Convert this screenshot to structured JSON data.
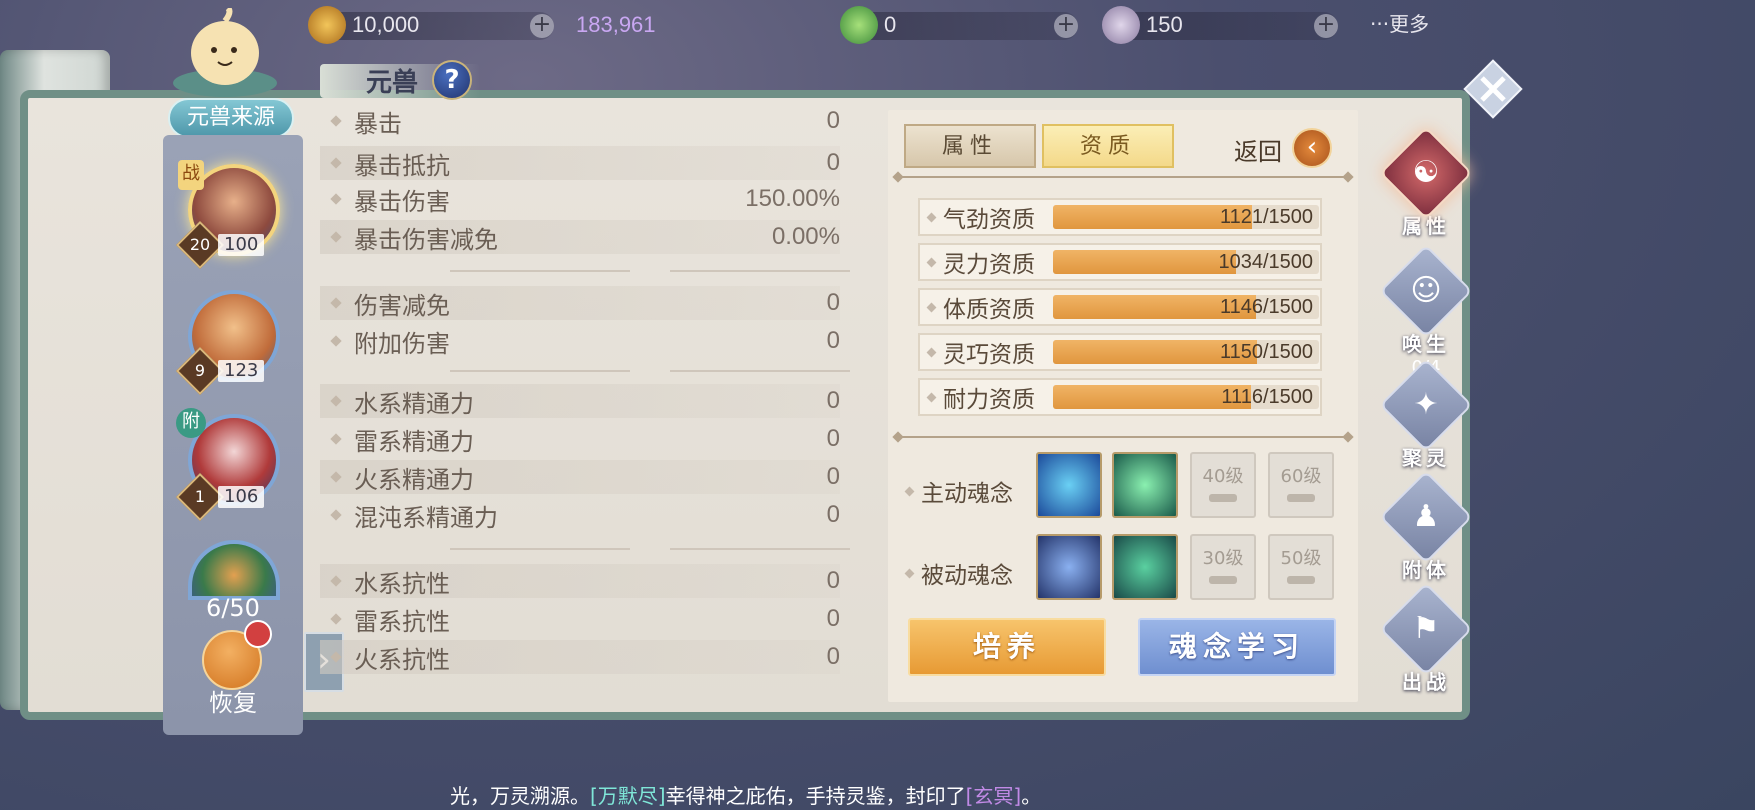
{
  "resources": [
    {
      "icon": "gold-shell-icon",
      "value": "10,000",
      "color": "#e8e6ee"
    },
    {
      "icon": "bronze-shell-icon",
      "value": "183,961",
      "color": "#c9a7f2"
    },
    {
      "icon": "jade-leaf-icon",
      "value": "0",
      "color": "#e8e6ee"
    },
    {
      "icon": "spirit-crystal-icon",
      "value": "150",
      "color": "#e8e6ee"
    }
  ],
  "more_label": "···更多",
  "header": {
    "title": "元兽",
    "help": "?"
  },
  "source_button": "元兽来源",
  "pets": [
    {
      "tag": "战",
      "level": "20",
      "count": "100",
      "active": true
    },
    {
      "tag": "",
      "level": "9",
      "count": "123",
      "active": false
    },
    {
      "tag": "附",
      "level": "1",
      "count": "106",
      "active": false
    },
    {
      "tag": "",
      "level": "",
      "count": "",
      "active": false
    }
  ],
  "pet_count": "6/50",
  "recover_label": "恢复",
  "expand_label": "›",
  "attributes": [
    {
      "name": "暴击",
      "value": "0"
    },
    {
      "name": "暴击抵抗",
      "value": "0"
    },
    {
      "name": "暴击伤害",
      "value": "150.00%"
    },
    {
      "name": "暴击伤害减免",
      "value": "0.00%"
    },
    {
      "name": "伤害减免",
      "value": "0"
    },
    {
      "name": "附加伤害",
      "value": "0"
    },
    {
      "name": "水系精通力",
      "value": "0"
    },
    {
      "name": "雷系精通力",
      "value": "0"
    },
    {
      "name": "火系精通力",
      "value": "0"
    },
    {
      "name": "混沌系精通力",
      "value": "0"
    },
    {
      "name": "水系抗性",
      "value": "0"
    },
    {
      "name": "雷系抗性",
      "value": "0"
    },
    {
      "name": "火系抗性",
      "value": "0"
    }
  ],
  "tabs": {
    "attributes": "属性",
    "qualification": "资质"
  },
  "back_label": "返回",
  "qualifications": [
    {
      "label": "气劲资质",
      "value": 1121,
      "max": 1500,
      "text": "1121/1500"
    },
    {
      "label": "灵力资质",
      "value": 1034,
      "max": 1500,
      "text": "1034/1500"
    },
    {
      "label": "体质资质",
      "value": 1146,
      "max": 1500,
      "text": "1146/1500"
    },
    {
      "label": "灵巧资质",
      "value": 1150,
      "max": 1500,
      "text": "1150/1500"
    },
    {
      "label": "耐力资质",
      "value": 1116,
      "max": 1500,
      "text": "1116/1500"
    }
  ],
  "active_skills": {
    "label": "主动魂念",
    "locked": [
      "40级",
      "60级"
    ]
  },
  "passive_skills": {
    "label": "被动魂念",
    "locked": [
      "30级",
      "50级"
    ]
  },
  "buttons": {
    "cultivate": "培养",
    "learn": "魂念学习"
  },
  "right_nav": [
    {
      "label": "属性",
      "sub": "",
      "icon": "yin-yang-icon",
      "active": true
    },
    {
      "label": "唤生",
      "sub": "0/4",
      "icon": "summon-icon",
      "active": false
    },
    {
      "label": "聚灵",
      "sub": "",
      "icon": "spirit-gather-icon",
      "active": false
    },
    {
      "label": "附体",
      "sub": "",
      "icon": "possess-icon",
      "active": false
    },
    {
      "label": "出战",
      "sub": "",
      "icon": "battle-banner-icon",
      "active": false
    }
  ],
  "ticker": {
    "part1": "光，万灵溯源。",
    "name1": "[万默尽]",
    "part2": "幸得神之庇佑，手持灵鉴，封印了",
    "name2": "[玄冥]",
    "part3": "。"
  }
}
